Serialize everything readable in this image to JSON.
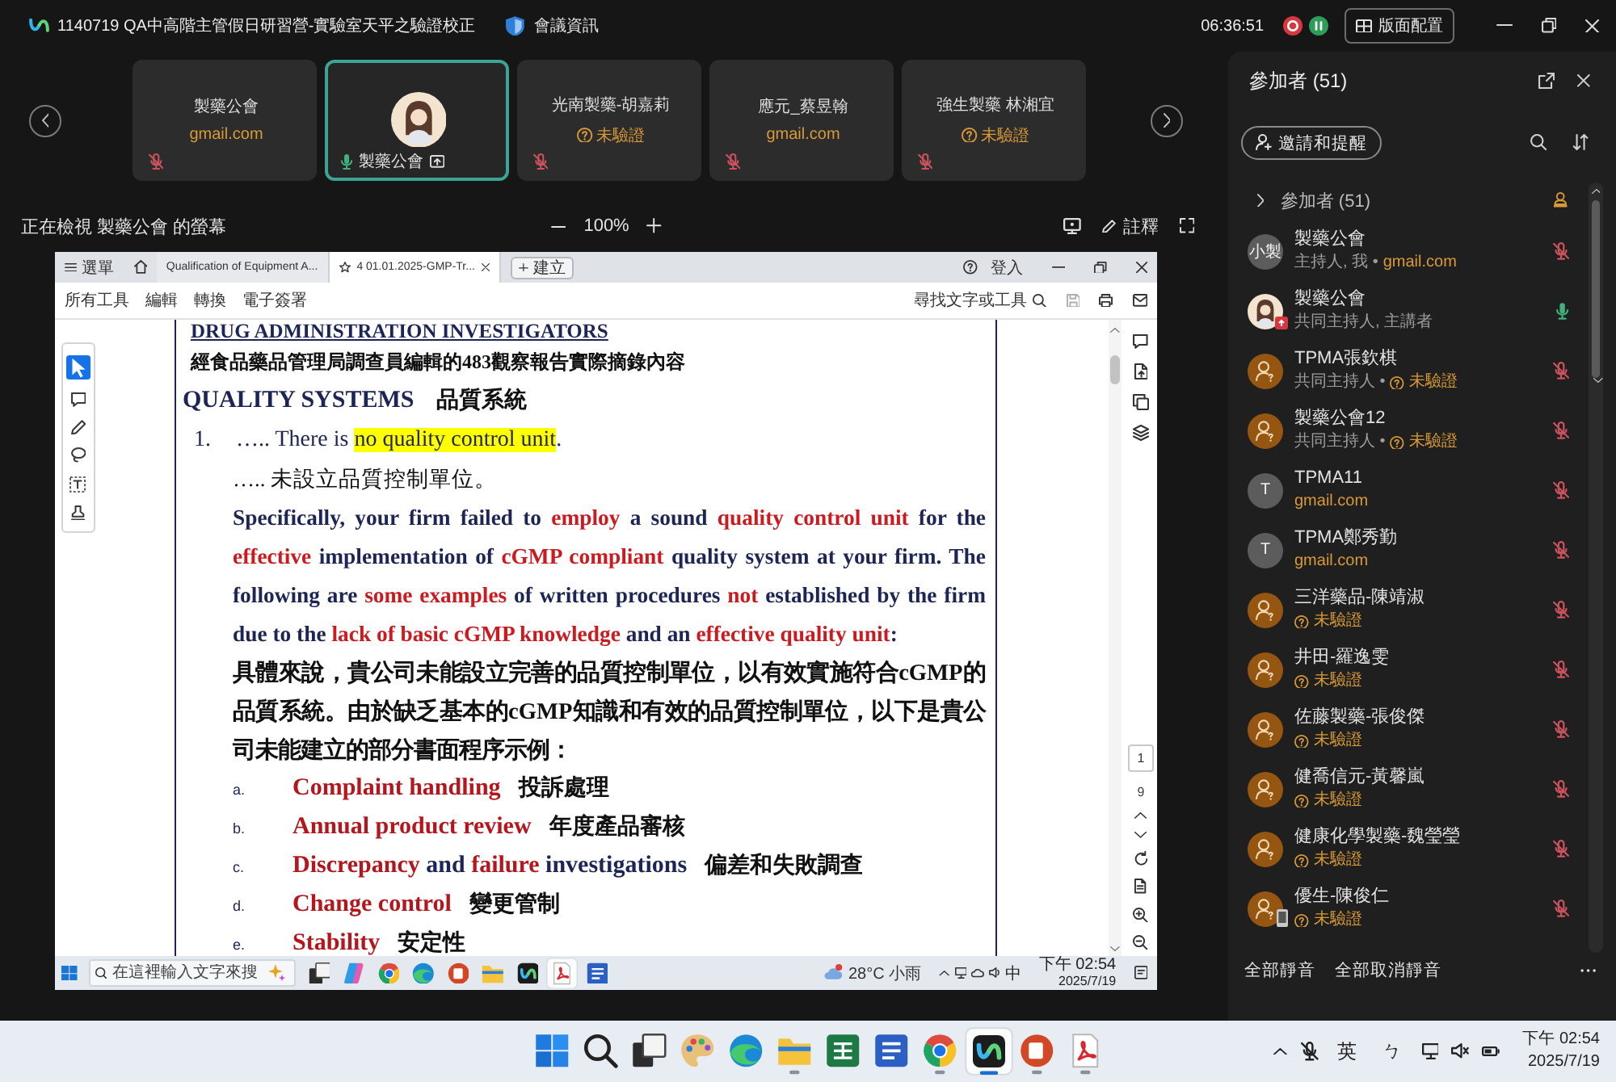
{
  "window": {
    "title": "1140719 QA中高階主管假日研習營-實驗室天平之驗證校正",
    "info": "會議資訊",
    "timer": "06:36:51",
    "layout_button": "版面配置"
  },
  "video_strip": {
    "tiles": [
      {
        "kind": "text",
        "name": "製藥公會",
        "email": "gmail.com",
        "muted": true,
        "selected": false
      },
      {
        "kind": "avatar",
        "name": "製藥公會",
        "muted": false,
        "sharing": true,
        "selected": true
      },
      {
        "kind": "text",
        "name": "光南製藥-胡嘉莉",
        "verification": "未驗證",
        "muted": true,
        "selected": false
      },
      {
        "kind": "text",
        "name": "應元_蔡昱翰",
        "email": "gmail.com",
        "muted": true,
        "selected": false
      },
      {
        "kind": "text",
        "name": "強生製藥 林湘宜",
        "verification": "未驗證",
        "muted": true,
        "selected": false
      }
    ]
  },
  "share_bar": {
    "label": "正在檢視 製藥公會 的螢幕",
    "zoom": "100%",
    "annotate_button": "註釋"
  },
  "shared_screen": {
    "tab_bar": {
      "menu": "選單",
      "tabs": [
        {
          "label": "Qualification of Equipment A...",
          "selected": false
        },
        {
          "label": "4 01.01.2025-GMP-Tr...",
          "selected": true
        }
      ],
      "new_button": "建立",
      "sign_in": "登入"
    },
    "toolbar": {
      "items": [
        "所有工具",
        "編輯",
        "轉換",
        "電子簽署"
      ],
      "search": "尋找文字或工具"
    },
    "tools": [
      {
        "kind": "select",
        "selected": true
      },
      {
        "kind": "comment",
        "selected": false
      },
      {
        "kind": "draw",
        "selected": false
      },
      {
        "kind": "lasso",
        "selected": false
      },
      {
        "kind": "text",
        "selected": false
      },
      {
        "kind": "stamp",
        "selected": false
      }
    ],
    "document": {
      "heading": "DRUG ADMINISTRATION INVESTIGATORS",
      "subtitle": "經食品藥品管理局調查員編輯的483觀察報告實際摘錄內容",
      "section_title": "QUALITY SYSTEMS",
      "section_title_zh": "品質系統",
      "finding": {
        "number": "1.",
        "text": [
          {
            "text": "….. There is ",
            "highlight": false
          },
          {
            "text": "no quality control unit",
            "highlight": true
          },
          {
            "text": ".",
            "highlight": false
          }
        ],
        "translation": "….. 未設立品質控制單位。"
      },
      "paragraph": [
        {
          "text": "Specifically, your firm failed to ",
          "emphasis": false
        },
        {
          "text": "employ",
          "emphasis": true
        },
        {
          "text": " a sound ",
          "emphasis": false
        },
        {
          "text": "quality control unit",
          "emphasis": true
        },
        {
          "text": " for the ",
          "emphasis": false
        },
        {
          "text": "effective",
          "emphasis": true
        },
        {
          "text": " implementation of ",
          "emphasis": false
        },
        {
          "text": "cGMP compliant",
          "emphasis": true
        },
        {
          "text": " quality system at your firm.  The following are ",
          "emphasis": false
        },
        {
          "text": "some examples",
          "emphasis": true
        },
        {
          "text": " of written procedures ",
          "emphasis": false
        },
        {
          "text": "not",
          "emphasis": true
        },
        {
          "text": " established by the firm due to the ",
          "emphasis": false
        },
        {
          "text": "lack of basic cGMP knowledge",
          "emphasis": true
        },
        {
          "text": " and an ",
          "emphasis": false
        },
        {
          "text": "effective quality unit",
          "emphasis": true
        },
        {
          "text": ":",
          "emphasis": false
        }
      ],
      "paragraph_zh": "具體來說，貴公司未能設立完善的品質控制單位，以有效實施符合cGMP的品質系統。由於缺乏基本的cGMP知識和有效的品質控制單位，以下是貴公司未能建立的部分書面程序示例：",
      "examples": [
        {
          "marker": "a.",
          "text": [
            {
              "text": "Complaint handling",
              "emphasis": true
            }
          ],
          "translation": "投訴處理"
        },
        {
          "marker": "b.",
          "text": [
            {
              "text": "Annual product review",
              "emphasis": true
            }
          ],
          "translation": "年度產品審核"
        },
        {
          "marker": "c.",
          "text": [
            {
              "text": "Discrepancy",
              "emphasis": true
            },
            {
              "text": " and ",
              "emphasis": false
            },
            {
              "text": "failure",
              "emphasis": true
            },
            {
              "text": " investigations",
              "emphasis": false
            }
          ],
          "translation": "偏差和失敗調查"
        },
        {
          "marker": "d.",
          "text": [
            {
              "text": "Change control",
              "emphasis": true
            }
          ],
          "translation": "變更管制"
        },
        {
          "marker": "e.",
          "text": [
            {
              "text": "Stability",
              "emphasis": true
            }
          ],
          "translation": "安定性"
        }
      ]
    },
    "page": {
      "current": "1",
      "total": "9"
    },
    "taskbar": {
      "search_placeholder": "在這裡輸入文字來搜",
      "apps": [
        {
          "kind": "tasks",
          "selected": false
        },
        {
          "kind": "assistant",
          "selected": false
        },
        {
          "kind": "globe",
          "selected": false
        },
        {
          "kind": "wave",
          "selected": false
        },
        {
          "kind": "slides",
          "selected": false
        },
        {
          "kind": "folder",
          "selected": false
        },
        {
          "kind": "meeting",
          "selected": false
        },
        {
          "kind": "pdf",
          "selected": true
        },
        {
          "kind": "docs",
          "selected": false
        }
      ],
      "weather": "28°C 小雨",
      "input_method": "中",
      "time": "下午 02:54",
      "date": "2025/7/19"
    }
  },
  "participants_panel": {
    "title": "參加者 (51)",
    "invite_button": "邀請和提醒",
    "group_label": "參加者 (51)",
    "participants": [
      {
        "name": "製藥公會",
        "avatar": {
          "kind": "initials",
          "text": "小製"
        },
        "role": "主持人, 我 •",
        "email": "gmail.com",
        "muted": true
      },
      {
        "name": "製藥公會",
        "avatar": {
          "kind": "picture",
          "badge": {
            "kind": "share"
          }
        },
        "role": "共同主持人, 主講者",
        "muted": false
      },
      {
        "name": "TPMA張欽棋",
        "avatar": {
          "kind": "guest"
        },
        "role": "共同主持人 •",
        "verification": "未驗證",
        "muted": true
      },
      {
        "name": "製藥公會12",
        "avatar": {
          "kind": "guest"
        },
        "role": "共同主持人 •",
        "verification": "未驗證",
        "muted": true
      },
      {
        "name": "TPMA11",
        "avatar": {
          "kind": "initials",
          "text": "T"
        },
        "email": "gmail.com",
        "muted": true
      },
      {
        "name": "TPMA鄭秀勤",
        "avatar": {
          "kind": "initials",
          "text": "T"
        },
        "email": "gmail.com",
        "muted": true
      },
      {
        "name": "三洋藥品-陳靖淑",
        "avatar": {
          "kind": "guest"
        },
        "verification": "未驗證",
        "muted": true
      },
      {
        "name": "井田-羅逸雯",
        "avatar": {
          "kind": "guest"
        },
        "verification": "未驗證",
        "muted": true
      },
      {
        "name": "佐藤製藥-張俊傑",
        "avatar": {
          "kind": "guest"
        },
        "verification": "未驗證",
        "muted": true
      },
      {
        "name": "健喬信元-黃馨嵐",
        "avatar": {
          "kind": "guest"
        },
        "verification": "未驗證",
        "muted": true
      },
      {
        "name": "健康化學製藥-魏瑩瑩",
        "avatar": {
          "kind": "guest"
        },
        "verification": "未驗證",
        "muted": true
      },
      {
        "name": "優生-陳俊仁",
        "avatar": {
          "kind": "guest",
          "badge": {
            "kind": "phone"
          }
        },
        "verification": "未驗證",
        "muted": true
      }
    ],
    "footer": {
      "mute_all": "全部靜音",
      "unmute_all": "全部取消靜音"
    }
  },
  "taskbar": {
    "apps": [
      {
        "kind": "start",
        "running": false,
        "selected": false
      },
      {
        "kind": "search",
        "running": false,
        "selected": false
      },
      {
        "kind": "tasks",
        "running": false,
        "selected": false
      },
      {
        "kind": "palette",
        "running": false,
        "selected": false
      },
      {
        "kind": "wave",
        "running": false,
        "selected": false
      },
      {
        "kind": "folder",
        "running": true,
        "selected": false
      },
      {
        "kind": "sheets",
        "running": false,
        "selected": false
      },
      {
        "kind": "docs",
        "running": false,
        "selected": false
      },
      {
        "kind": "globe",
        "running": true,
        "selected": false
      },
      {
        "kind": "meeting",
        "running": true,
        "selected": true
      },
      {
        "kind": "slides",
        "running": true,
        "selected": false
      },
      {
        "kind": "pdf",
        "running": true,
        "selected": false
      }
    ],
    "input_language": "英",
    "input_mode": "ㄅ",
    "time": "下午 02:54",
    "date": "2025/7/19"
  }
}
